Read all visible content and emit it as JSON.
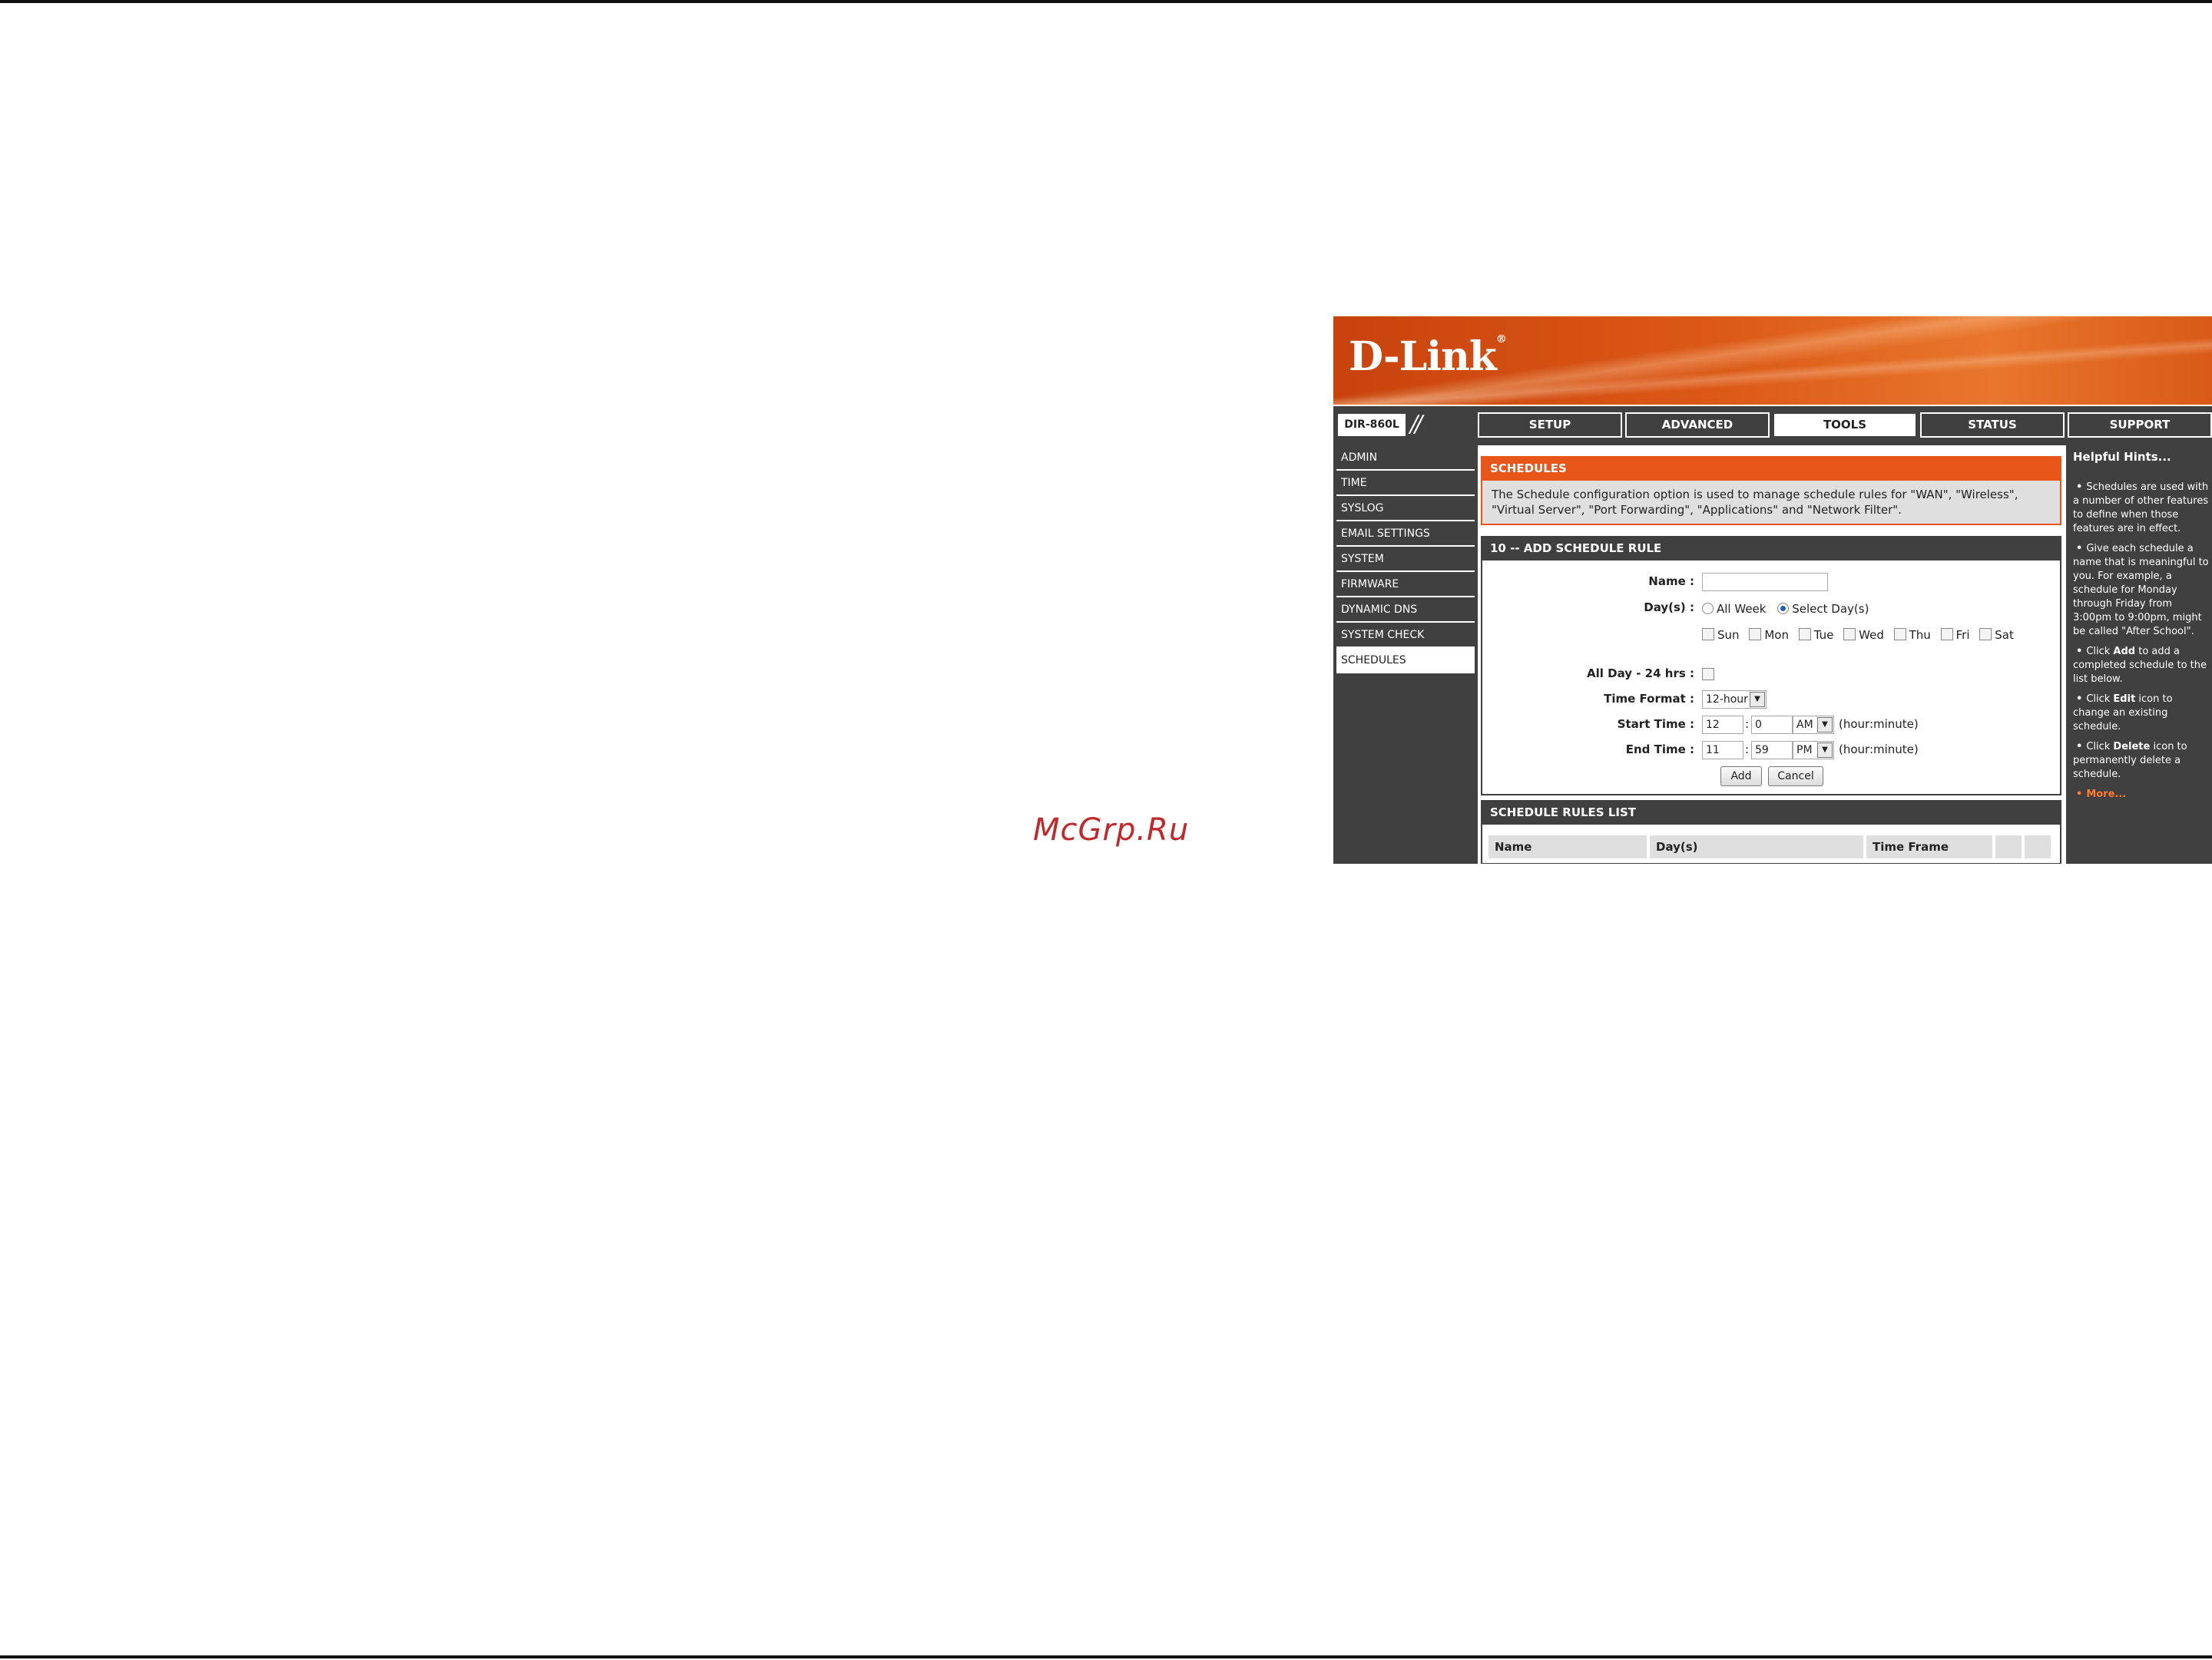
{
  "watermark": "McGrp.Ru",
  "brand": {
    "logo": "D-Link",
    "reg_mark": "®"
  },
  "model": "DIR-860L",
  "tabs": [
    {
      "label": "SETUP"
    },
    {
      "label": "ADVANCED"
    },
    {
      "label": "TOOLS",
      "active": true
    },
    {
      "label": "STATUS"
    },
    {
      "label": "SUPPORT"
    }
  ],
  "sidebar": {
    "items": [
      {
        "label": "ADMIN"
      },
      {
        "label": "TIME"
      },
      {
        "label": "SYSLOG"
      },
      {
        "label": "EMAIL SETTINGS"
      },
      {
        "label": "SYSTEM"
      },
      {
        "label": "FIRMWARE"
      },
      {
        "label": "DYNAMIC DNS"
      },
      {
        "label": "SYSTEM CHECK"
      },
      {
        "label": "SCHEDULES",
        "active": true
      }
    ]
  },
  "schedules": {
    "title": "SCHEDULES",
    "description": "The Schedule configuration option is used to manage schedule rules for \"WAN\", \"Wireless\", \"Virtual Server\", \"Port Forwarding\", \"Applications\" and \"Network Filter\"."
  },
  "add_rule": {
    "title": "10 -- ADD SCHEDULE RULE",
    "name_label": "Name  :",
    "name_value": "",
    "days_label": "Day(s)  :",
    "all_week_label": "All Week",
    "select_days_label": "Select Day(s)",
    "days": [
      "Sun",
      "Mon",
      "Tue",
      "Wed",
      "Thu",
      "Fri",
      "Sat"
    ],
    "all_day_label": "All Day - 24 hrs  :",
    "time_format_label": "Time Format  :",
    "time_format_value": "12-hour",
    "start_time_label": "Start Time  :",
    "start_hour": "12",
    "start_minute": "0",
    "start_ampm": "AM",
    "end_time_label": "End Time  :",
    "end_hour": "11",
    "end_minute": "59",
    "end_ampm": "PM",
    "colon": ":",
    "hour_minute_hint": "(hour:minute)",
    "add_button": "Add",
    "cancel_button": "Cancel"
  },
  "rules_list": {
    "title": "SCHEDULE RULES LIST",
    "columns": [
      "Name",
      "Day(s)",
      "Time Frame"
    ]
  },
  "hints": {
    "title": "Helpful Hints...",
    "bullet": "•",
    "h1": "Schedules are used with a number of other features to define when those features are in effect.",
    "h2": "Give each schedule a name that is meaningful to you. For example, a schedule for Monday through Friday from 3:00pm to 9:00pm, might be called \"After School\".",
    "h3_pre": "Click ",
    "h3_bold": "Add",
    "h3_post": " to add a completed schedule to the list below.",
    "h4_pre": "Click ",
    "h4_bold": "Edit",
    "h4_post": " icon to change an existing schedule.",
    "h5_pre": "Click ",
    "h5_bold": "Delete",
    "h5_post": " icon to permanently delete a schedule.",
    "more": "More..."
  },
  "colors": {
    "brand_orange": "#e8561a",
    "chrome_dark": "#404040",
    "more_link": "#ff7a30",
    "watermark": "#c0282a"
  }
}
